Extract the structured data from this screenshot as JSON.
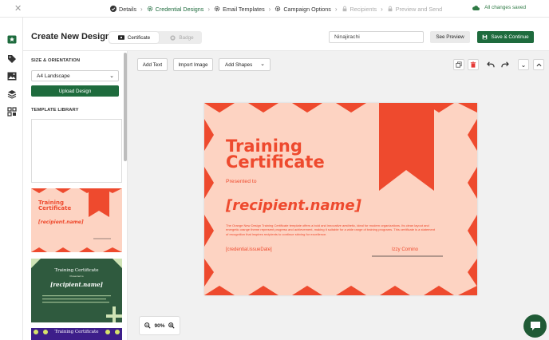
{
  "close_icon": "close-icon",
  "steps": [
    {
      "label": "Details",
      "state": "done",
      "icon": "check-circle-icon"
    },
    {
      "label": "Credential Designs",
      "state": "active",
      "icon": "gear-icon"
    },
    {
      "label": "Email Templates",
      "state": "normal",
      "icon": "gear-icon"
    },
    {
      "label": "Campaign Options",
      "state": "normal",
      "icon": "gear-icon"
    },
    {
      "label": "Recipients",
      "state": "disabled",
      "icon": "lock-icon"
    },
    {
      "label": "Preview and Send",
      "state": "disabled",
      "icon": "lock-icon"
    }
  ],
  "status": {
    "saved_text": "All changes saved"
  },
  "rail": [
    "badge-star-icon",
    "tag-icon",
    "image-icon",
    "layers-icon",
    "grid-icon"
  ],
  "header": {
    "title": "Create New Design",
    "toggle": {
      "certificate": "Certificate",
      "badge": "Badge"
    },
    "name_value": "Ninajirachi",
    "preview_label": "See Preview",
    "save_label": "Save & Continue"
  },
  "panel": {
    "size_label": "SIZE & ORIENTATION",
    "size_value": "A4 Landscape",
    "upload_label": "Upload Design",
    "library_label": "TEMPLATE LIBRARY",
    "templates": [
      {
        "title": "Training Certificate",
        "name": "[recipient.name]",
        "style": "orange"
      },
      {
        "title": "Training Certificate",
        "subtitle": "Presented to",
        "name": "[recipient.name]",
        "style": "green"
      },
      {
        "title": "Training Certificate",
        "style": "purple"
      }
    ]
  },
  "toolbar": {
    "add_text": "Add Text",
    "import_image": "Import Image",
    "add_shapes": "Add Shapes"
  },
  "certificate": {
    "title_line1": "Training",
    "title_line2": "Certificate",
    "presented": "Presented to",
    "name": "[recipient.name]",
    "description": "The Orange New Design Training Certificate template offers a bold and innovative aesthetic, ideal for modern organizations. Its clean layout and energetic orange theme represent progress and achievement, making it suitable for a wide range of training programs. This certificate is a statement of recognition that inspires recipients to continue striving for excellence.",
    "date": "[credential.issueDate]",
    "signature": "Izzy Comino"
  },
  "zoom": {
    "value": "90%"
  },
  "colors": {
    "brand": "#1e6b3d",
    "accent": "#ee4a2e",
    "cert_bg": "#fdd3c2"
  }
}
